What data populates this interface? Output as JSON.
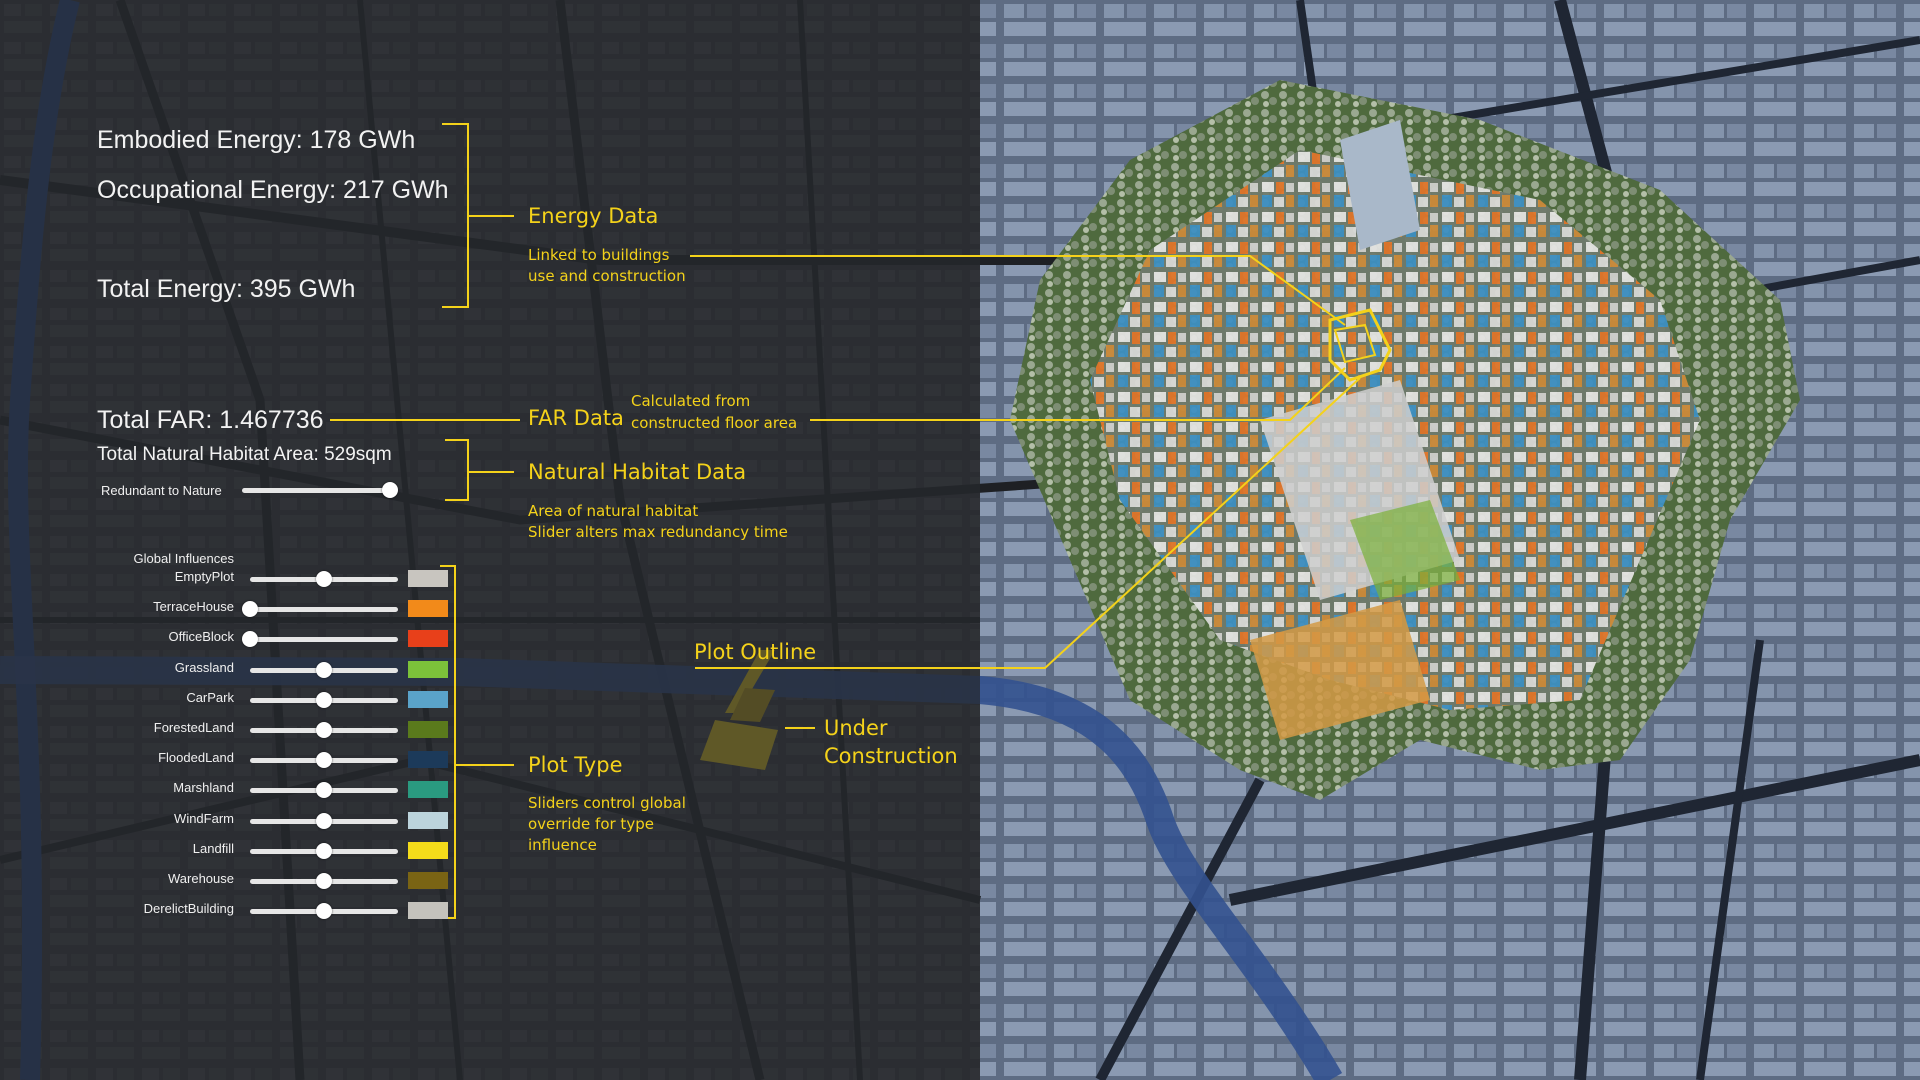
{
  "energy": {
    "embodied": "Embodied Energy: 178 GWh",
    "occupational": "Occupational Energy: 217 GWh",
    "total": "Total Energy: 395 GWh"
  },
  "far": {
    "total": "Total FAR: 1.467736"
  },
  "habitat": {
    "area": "Total Natural Habitat Area: 529sqm",
    "slider_label": "Redundant to Nature",
    "slider_value": 1.0
  },
  "global_influences": {
    "title": "Global Influences",
    "rows": [
      {
        "label": "EmptyPlot",
        "value": 0.5,
        "color": "#c8c5bf"
      },
      {
        "label": "TerraceHouse",
        "value": 0.0,
        "color": "#f28a1a"
      },
      {
        "label": "OfficeBlock",
        "value": 0.0,
        "color": "#e8401a"
      },
      {
        "label": "Grassland",
        "value": 0.5,
        "color": "#7cc23a"
      },
      {
        "label": "CarPark",
        "value": 0.5,
        "color": "#5aa3c9"
      },
      {
        "label": "ForestedLand",
        "value": 0.5,
        "color": "#5a7a1c"
      },
      {
        "label": "FloodedLand",
        "value": 0.5,
        "color": "#1c3a5a"
      },
      {
        "label": "Marshland",
        "value": 0.5,
        "color": "#2a9a80"
      },
      {
        "label": "WindFarm",
        "value": 0.5,
        "color": "#bcd4dc"
      },
      {
        "label": "Landfill",
        "value": 0.5,
        "color": "#f4dc1a"
      },
      {
        "label": "Warehouse",
        "value": 0.5,
        "color": "#7a6414"
      },
      {
        "label": "DerelictBuilding",
        "value": 0.5,
        "color": "#c4c2bc"
      }
    ]
  },
  "annotations": {
    "energy_data": "Energy Data",
    "energy_note_1": "Linked to buildings",
    "energy_note_2": "use and construction",
    "far_data": "FAR Data",
    "far_note_1": "Calculated from",
    "far_note_2": "constructed floor area",
    "habitat_data": "Natural Habitat Data",
    "habitat_note_1": "Area of natural habitat",
    "habitat_note_2": "Slider alters max redundancy time",
    "plot_outline": "Plot Outline",
    "plot_type": "Plot Type",
    "plot_note_1": "Sliders control global",
    "plot_note_2": "override for type",
    "plot_note_3": "influence",
    "under_1": "Under",
    "under_2": "Construction"
  },
  "colors": {
    "accent": "#f4d21a",
    "river": "#3a5aa8"
  }
}
